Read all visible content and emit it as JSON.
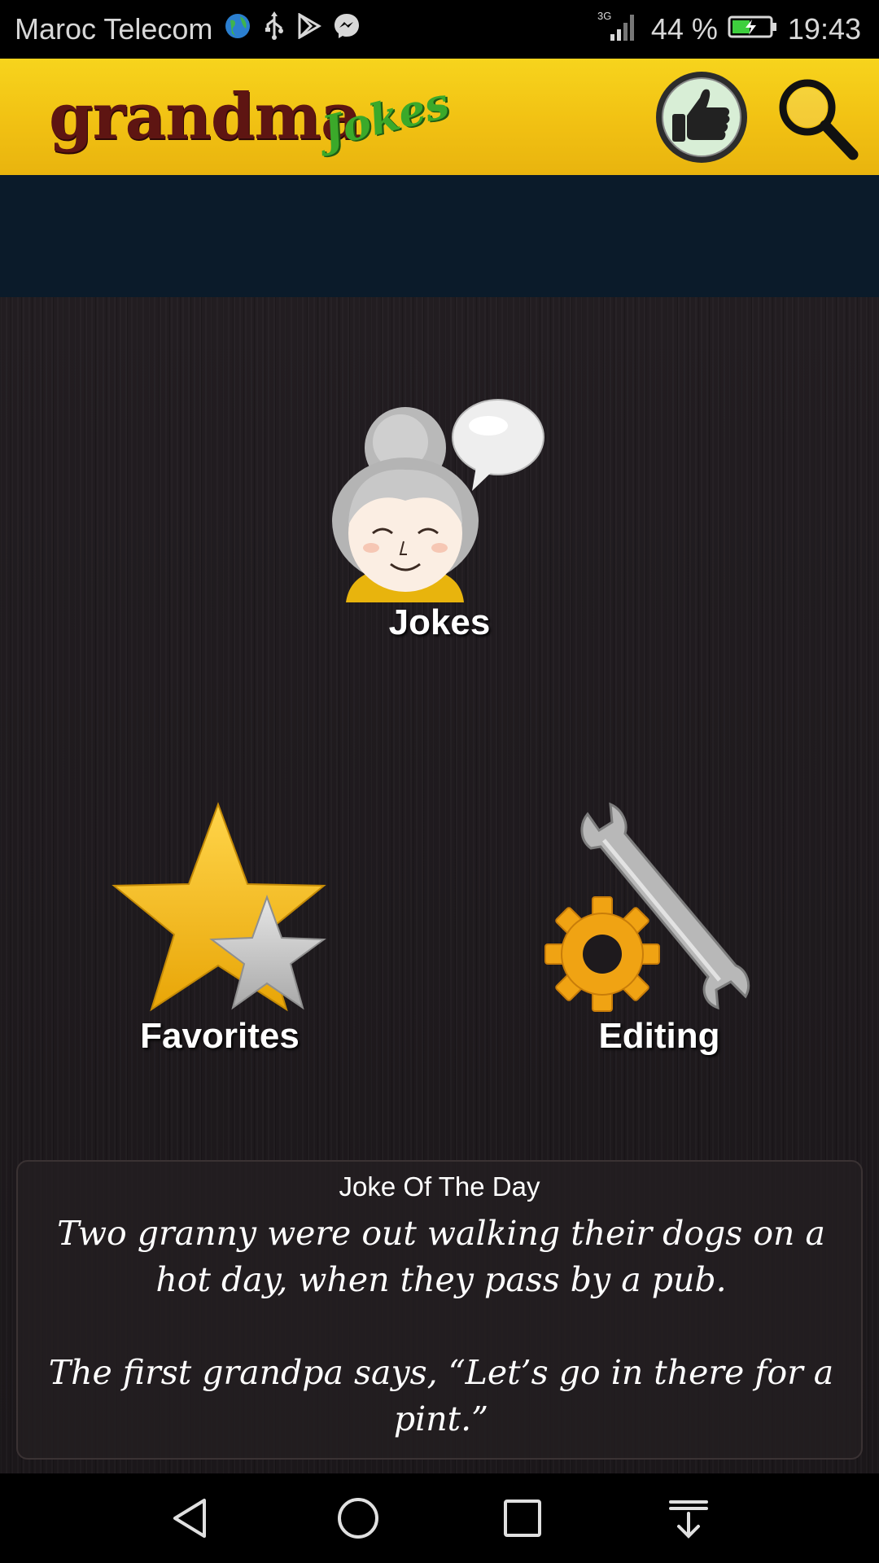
{
  "status_bar": {
    "carrier": "Maroc Telecom",
    "network": "3G",
    "battery": "44 %",
    "time": "19:43"
  },
  "app": {
    "logo_main": "grandma",
    "logo_sub": "Jokes"
  },
  "menu": {
    "jokes_label": "Jokes",
    "favorites_label": "Favorites",
    "editing_label": "Editing"
  },
  "joke_of_day": {
    "title": "Joke Of The Day",
    "text": "Two granny were out walking their dogs on a hot day, when they pass by a pub.\n\nThe first grandpa says, “Let’s go in there for a pint.”"
  },
  "colors": {
    "header_yellow": "#f1c113",
    "logo_red": "#5e1512",
    "logo_green": "#3ba92a",
    "banner_navy": "#0b1b2a",
    "star_gold": "#f3b80c",
    "gear_orange": "#f0a313"
  },
  "icons": [
    "globe-icon",
    "usb-icon",
    "play-store-icon",
    "messenger-icon",
    "signal-icon",
    "battery-icon",
    "thumbs-up-icon",
    "search-icon",
    "grandma-icon",
    "speech-bubble-icon",
    "star-icon",
    "gear-icon",
    "wrench-icon",
    "back-icon",
    "home-icon",
    "recents-icon",
    "notification-pull-icon"
  ]
}
